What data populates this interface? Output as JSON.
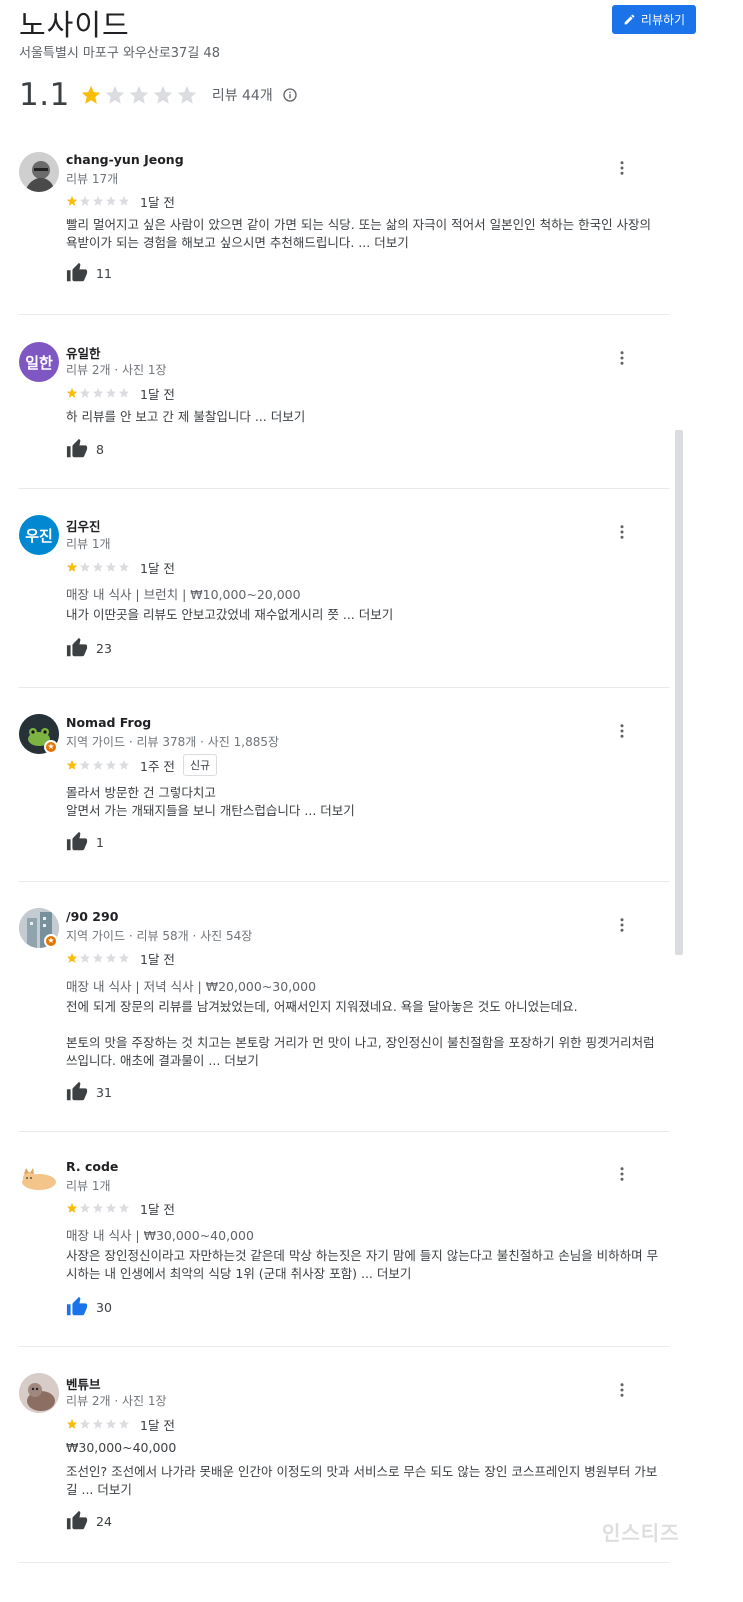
{
  "header": {
    "title": "노사이드",
    "address": "서울특별시 마포구 와우산로37길 48",
    "write_review_label": "리뷰하기",
    "rating": "1.1",
    "review_count": "리뷰 44개"
  },
  "colors": {
    "accent": "#1a73e8",
    "star_filled": "#fbbc04",
    "star_empty": "#dadce0"
  },
  "reviews": [
    {
      "name": "chang-yun Jeong",
      "meta": "리뷰 17개",
      "stars": 1,
      "time": "1달 전",
      "text": "빨리 멀어지고 싶은 사람이 았으면 같이 가면 되는 식당. 또는 삶의 자극이 적어서 일본인인 척하는 한국인 사장의 욕받이가 되는 경험을 해보고 싶으시면 추천해드립니다. ...",
      "more": "더보기",
      "likes": "11"
    },
    {
      "name": "유일한",
      "avatar_text": "일한",
      "meta": "리뷰 2개 · 사진 1장",
      "stars": 1,
      "time": "1달 전",
      "text": "하 리뷰를 안 보고 간 제 불찰입니다 ...",
      "more": "더보기",
      "likes": "8"
    },
    {
      "name": "김우진",
      "avatar_text": "우진",
      "meta": "리뷰 1개",
      "stars": 1,
      "time": "1달 전",
      "meal": "매장 내 식사 | 브런치 | ₩10,000~20,000",
      "text": "내가 이딴곳을 리뷰도 안보고갔었네 재수없게시리 쯧 ...",
      "more": "더보기",
      "likes": "23"
    },
    {
      "name": "Nomad Frog",
      "meta": "지역 가이드 · 리뷰 378개 · 사진 1,885장",
      "stars": 1,
      "time": "1주 전",
      "badge": "신규",
      "text_lines": [
        "몰라서 방문한 건 그렇다치고",
        "알면서 가는 개돼지들을 보니 개탄스럽습니다 ..."
      ],
      "more": "더보기",
      "likes": "1"
    },
    {
      "name": "/90 290",
      "meta": "지역 가이드 · 리뷰 58개 · 사진 54장",
      "stars": 1,
      "time": "1달 전",
      "meal": "매장 내 식사 | 저녁 식사 | ₩20,000~30,000",
      "text_p1": "전에 되게 장문의 리뷰를 남겨놨었는데, 어째서인지 지워졌네요. 욕을 달아놓은 것도 아니었는데요.",
      "text_p2": "본토의 맛을 주장하는 것 치고는 본토랑 거리가 먼 맛이 나고, 장인정신이 불친절함을 포장하기 위한 핑곗거리처럼 쓰입니다. 애초에 결과물이 ...",
      "more": "더보기",
      "likes": "31"
    },
    {
      "name": "R. code",
      "meta": "리뷰 1개",
      "stars": 1,
      "time": "1달 전",
      "meal": "매장 내 식사 | ₩30,000~40,000",
      "text": "사장은 장인정신이라고 자만하는것 같은데 막상 하는짓은 자기 맘에 들지 않는다고 불친절하고 손님을 비하하며 무시하는 내 인생에서 최악의 식당 1위 (군대 취사장 포함) ...",
      "more": "더보기",
      "likes": "30"
    },
    {
      "name": "벤튜브",
      "meta": "리뷰 2개 · 사진 1장",
      "stars": 1,
      "time": "1달 전",
      "meal": "₩30,000~40,000",
      "text": "조선인? 조선에서 나가라 못배운 인간아 이정도의 맛과 서비스로 무슨 되도 않는 장인 코스프레인지 병원부터 가보길 ...",
      "more": "더보기",
      "likes": "24"
    }
  ],
  "watermark": "인스티즈"
}
